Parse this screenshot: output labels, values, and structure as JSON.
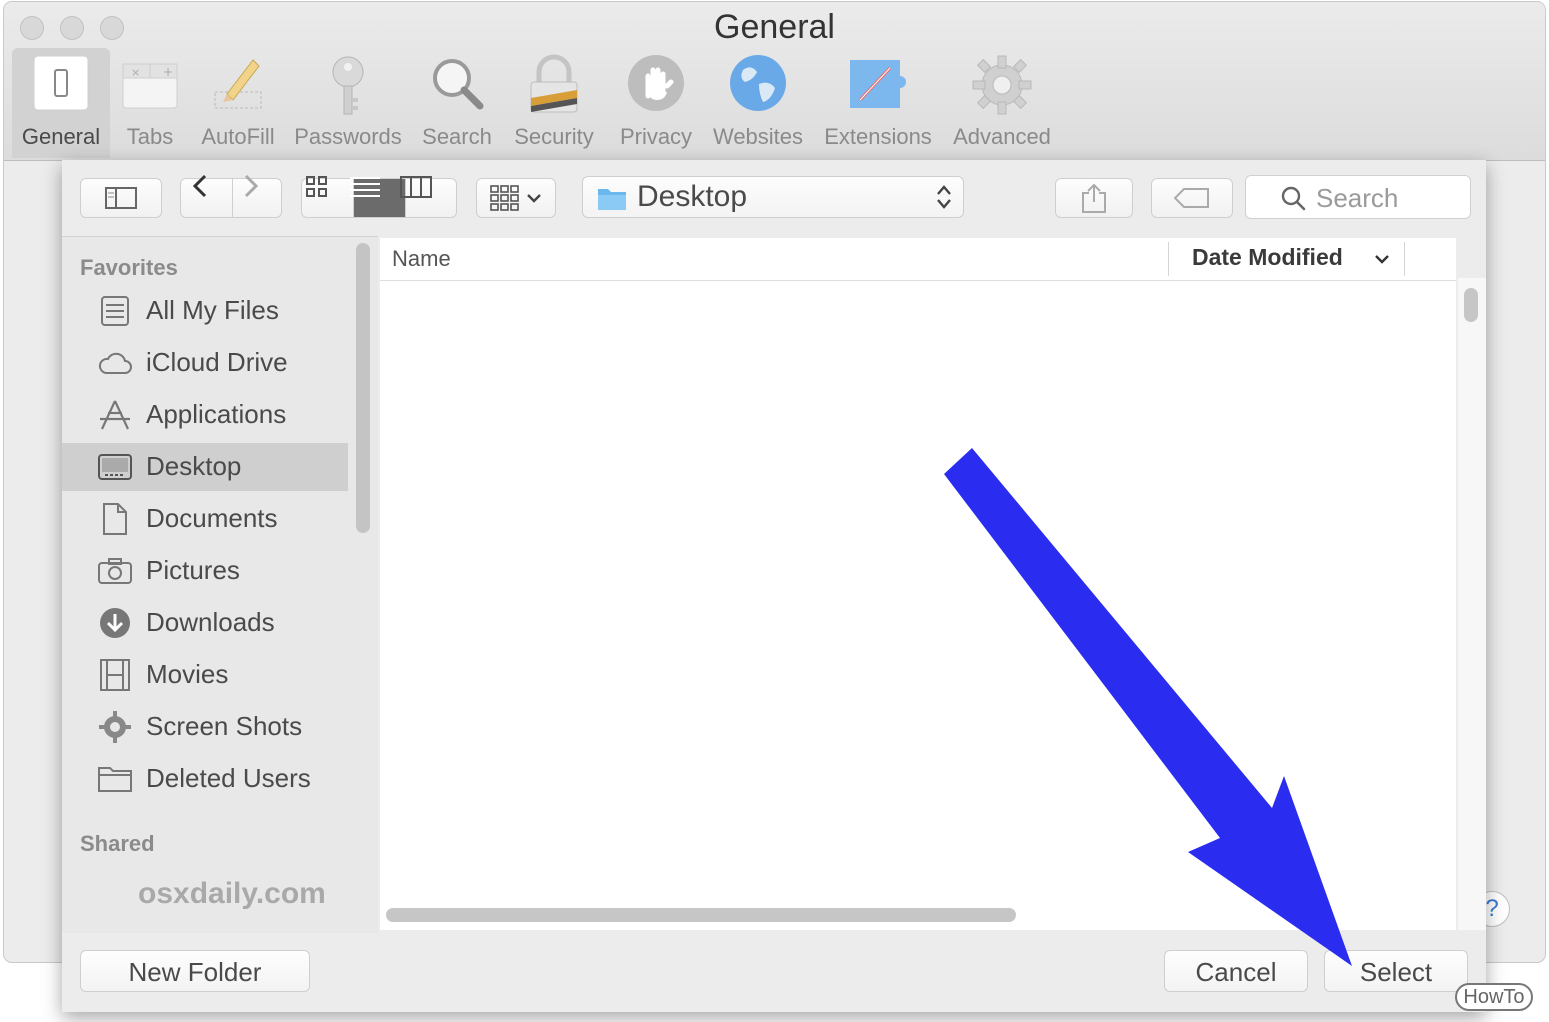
{
  "window": {
    "title": "General",
    "toolbar": [
      {
        "key": "general",
        "label": "General",
        "icon": "general-switch-icon"
      },
      {
        "key": "tabs",
        "label": "Tabs",
        "icon": "tabs-icon"
      },
      {
        "key": "autofill",
        "label": "AutoFill",
        "icon": "pencil-icon"
      },
      {
        "key": "passwords",
        "label": "Passwords",
        "icon": "key-icon"
      },
      {
        "key": "search",
        "label": "Search",
        "icon": "magnifier-icon"
      },
      {
        "key": "security",
        "label": "Security",
        "icon": "lock-icon"
      },
      {
        "key": "privacy",
        "label": "Privacy",
        "icon": "hand-icon"
      },
      {
        "key": "websites",
        "label": "Websites",
        "icon": "globe-icon"
      },
      {
        "key": "extensions",
        "label": "Extensions",
        "icon": "puzzle-compass-icon"
      },
      {
        "key": "advanced",
        "label": "Advanced",
        "icon": "gear-icon"
      }
    ],
    "help_label": "?"
  },
  "dialog": {
    "location": "Desktop",
    "search_placeholder": "Search",
    "sidebar": {
      "favorites_heading": "Favorites",
      "items": [
        {
          "label": "All My Files",
          "icon": "all-files-icon"
        },
        {
          "label": "iCloud Drive",
          "icon": "cloud-icon"
        },
        {
          "label": "Applications",
          "icon": "applications-icon"
        },
        {
          "label": "Desktop",
          "icon": "desktop-icon",
          "selected": true
        },
        {
          "label": "Documents",
          "icon": "document-icon"
        },
        {
          "label": "Pictures",
          "icon": "camera-icon"
        },
        {
          "label": "Downloads",
          "icon": "download-icon"
        },
        {
          "label": "Movies",
          "icon": "film-icon"
        },
        {
          "label": "Screen Shots",
          "icon": "gear-folder-icon"
        },
        {
          "label": "Deleted Users",
          "icon": "folder-icon"
        }
      ],
      "shared_heading": "Shared"
    },
    "columns": {
      "name": "Name",
      "date_modified": "Date Modified"
    },
    "buttons": {
      "new_folder": "New Folder",
      "cancel": "Cancel",
      "select": "Select"
    }
  },
  "watermark": "osxdaily.com",
  "badge": "HowTo",
  "colors": {
    "annotation_arrow": "#2a2cf0",
    "selection": "#cfcfcf",
    "accent": "#3a7bd5"
  }
}
